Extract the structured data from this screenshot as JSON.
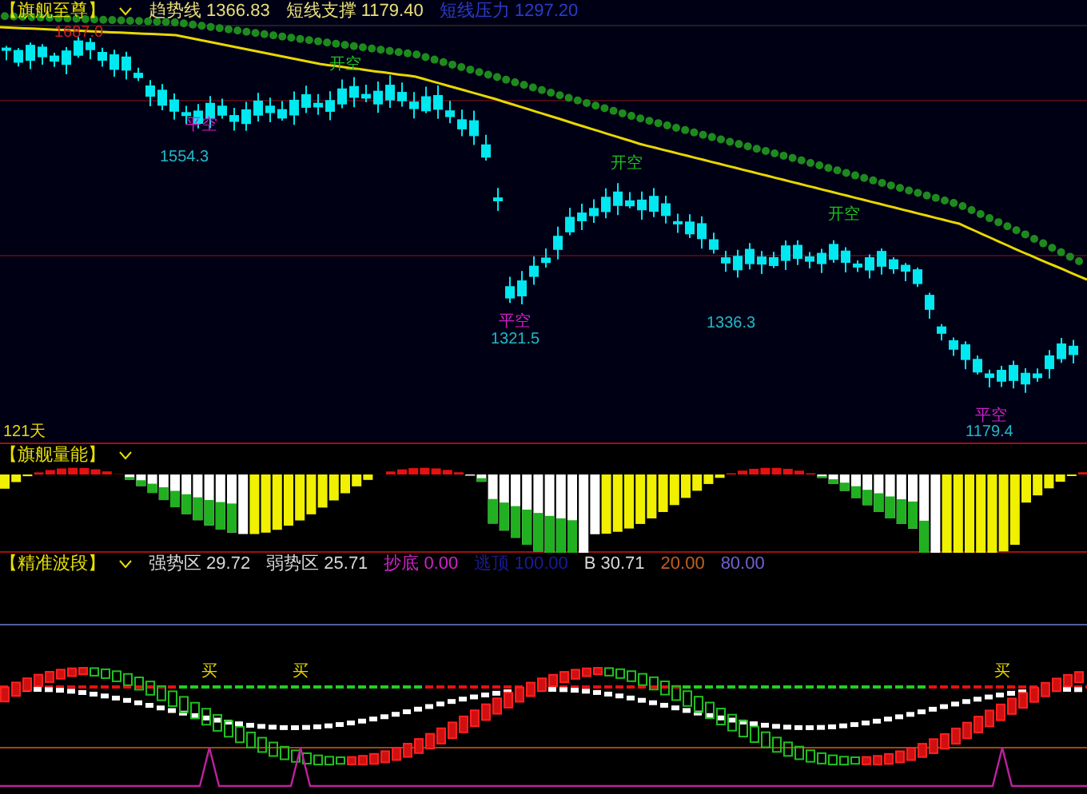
{
  "main_panel": {
    "title": "【旗舰至尊】",
    "indicators": [
      {
        "label": "趋势线",
        "value": "1366.83",
        "color": "#e8e07a"
      },
      {
        "label": "短线支撑",
        "value": "1179.40",
        "color": "#e8e07a"
      },
      {
        "label": "短线压力",
        "value": "1297.20",
        "color": "#2a3cc8"
      }
    ],
    "annotations": [
      {
        "kind": "high",
        "text": "1687.0"
      },
      {
        "kind": "close_short",
        "text": "平空"
      },
      {
        "kind": "low",
        "text": "1554.3"
      },
      {
        "kind": "open_short",
        "text": "开空"
      },
      {
        "kind": "open_short",
        "text": "开空"
      },
      {
        "kind": "close_short",
        "text": "平空"
      },
      {
        "kind": "low",
        "text": "1321.5"
      },
      {
        "kind": "low",
        "text": "1336.3"
      },
      {
        "kind": "open_short",
        "text": "开空"
      },
      {
        "kind": "close_short",
        "text": "平空"
      },
      {
        "kind": "low",
        "text": "1179.4"
      }
    ],
    "period": "121天"
  },
  "volume_panel": {
    "title": "【旗舰量能】"
  },
  "band_panel": {
    "title": "【精准波段】",
    "indicators": [
      {
        "label": "强势区",
        "value": "29.72",
        "color": "#d8d8d8"
      },
      {
        "label": "弱势区",
        "value": "25.71",
        "color": "#d8d8d8"
      },
      {
        "label": "抄底",
        "value": "0.00",
        "color": "#d020c8"
      },
      {
        "label": "逃顶",
        "value": "100.00",
        "color": "#1a1a9a"
      },
      {
        "label": "B",
        "value": "30.71",
        "color": "#d8d8d8"
      },
      {
        "value": "20.00",
        "color": "#c06020"
      },
      {
        "value": "80.00",
        "color": "#7060d0"
      }
    ],
    "signals": [
      {
        "text": "买"
      },
      {
        "text": "买"
      },
      {
        "text": "买"
      }
    ]
  }
}
